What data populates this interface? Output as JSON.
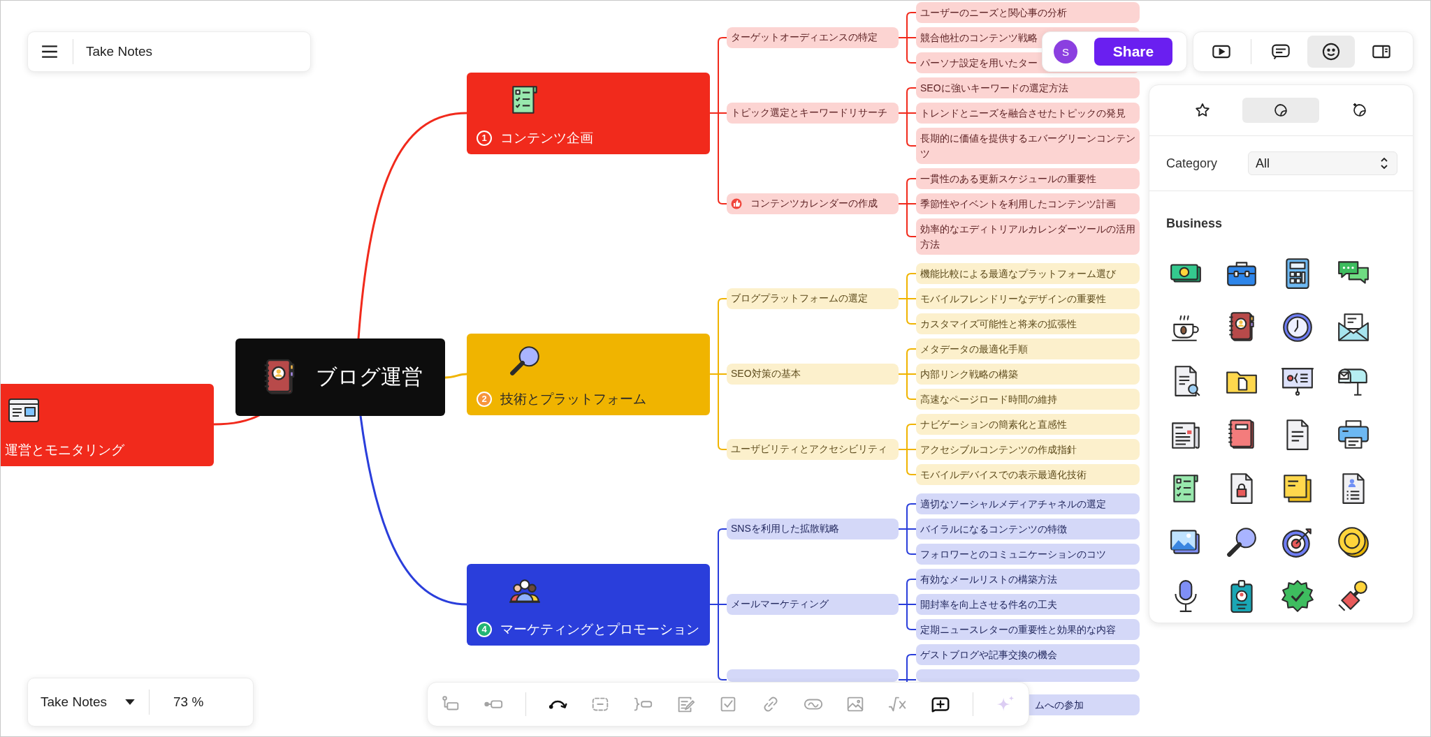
{
  "header": {
    "title": "Take Notes"
  },
  "share": {
    "avatar": "S",
    "button": "Share"
  },
  "view_buttons": [
    {
      "selected": false
    },
    {
      "selected": false
    },
    {
      "selected": true
    },
    {
      "selected": false
    }
  ],
  "panel": {
    "tabs": [
      {
        "selected": false
      },
      {
        "selected": true
      },
      {
        "selected": false
      }
    ],
    "category_label": "Category",
    "category_value": "All",
    "section": "Business"
  },
  "mindmap": {
    "root": "ブログ運営",
    "left_topic": {
      "label": "運営とモニタリング",
      "color": "#f12a1c"
    },
    "topics": [
      {
        "label": "コンテンツ企画",
        "color": "#f12a1c",
        "badge": {
          "text": "1",
          "color": "#f12a1c"
        },
        "subtopics": [
          {
            "kind": "text",
            "label": "ターゲットオーディエンスの特定",
            "leaves": [
              "ユーザーのニーズと関心事の分析",
              "競合他社のコンテンツ戦略",
              "パーソナ設定を用いたター"
            ]
          },
          {
            "kind": "text",
            "label": "トピック選定とキーワードリサーチ",
            "leaves": [
              "SEOに強いキーワードの選定方法",
              "トレンドとニーズを融合させたトピックの発見",
              "長期的に価値を提供するエバーグリーンコンテンツ"
            ]
          },
          {
            "kind": "icon",
            "label": "コンテンツカレンダーの作成",
            "leaves": [
              "一貫性のある更新スケジュールの重要性",
              "季節性やイベントを利用したコンテンツ計画",
              "効率的なエディトリアルカレンダーツールの活用方法"
            ]
          }
        ]
      },
      {
        "label": "技術とプラットフォーム",
        "color": "#f0b400",
        "badge": {
          "text": "2",
          "color": "#f7953b"
        },
        "subtopics": [
          {
            "kind": "text",
            "label": "ブログプラットフォームの選定",
            "leaves": [
              "機能比較による最適なプラットフォーム選び",
              "モバイルフレンドリーなデザインの重要性",
              "カスタマイズ可能性と将来の拡張性"
            ]
          },
          {
            "kind": "text",
            "label": "SEO対策の基本",
            "leaves": [
              "メタデータの最適化手順",
              "内部リンク戦略の構築",
              "高速なページロード時間の維持"
            ]
          },
          {
            "kind": "text",
            "label": "ユーザビリティとアクセシビリティ",
            "leaves": [
              "ナビゲーションの簡素化と直感性",
              "アクセシブルコンテンツの作成指針",
              "モバイルデバイスでの表示最適化技術"
            ]
          }
        ]
      },
      {
        "label": "マーケティングとプロモーション",
        "color": "#2a3edb",
        "badge": {
          "text": "4",
          "color": "#22b573"
        },
        "subtopics": [
          {
            "kind": "text",
            "label": "SNSを利用した拡散戦略",
            "leaves": [
              "適切なソーシャルメディアチャネルの選定",
              "バイラルになるコンテンツの特徴",
              "フォロワーとのコミュニケーションのコツ"
            ]
          },
          {
            "kind": "text",
            "label": "メールマーケティング",
            "leaves": [
              "有効なメールリストの構築方法",
              "開封率を向上させる件名の工夫",
              "定期ニュースレターの重要性と効果的な内容"
            ]
          },
          {
            "kind": "text",
            "leaves": [
              "ゲストブログや記事交換の機会"
            ],
            "tail": "ムへの参加"
          }
        ]
      }
    ]
  },
  "footer": {
    "document": "Take Notes",
    "zoom": "73 %"
  },
  "toolbar": [
    {
      "disabled": true
    },
    {
      "disabled": true
    },
    {
      "disabled": false
    },
    {
      "disabled": true
    },
    {
      "disabled": true
    },
    {
      "disabled": true
    },
    {
      "disabled": true
    },
    {
      "disabled": true
    },
    {
      "disabled": true
    },
    {
      "disabled": true
    },
    {
      "disabled": true
    },
    {
      "disabled": false
    },
    {
      "disabled": true
    }
  ]
}
